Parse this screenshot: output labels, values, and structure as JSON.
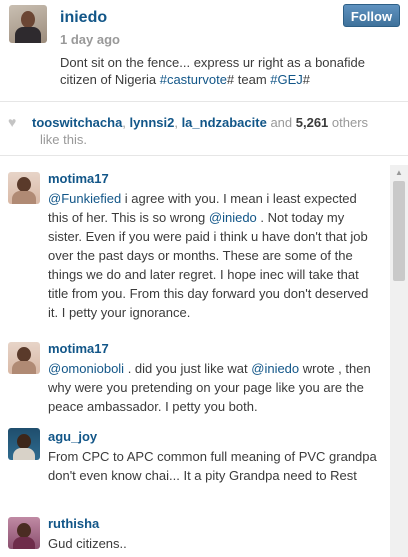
{
  "post": {
    "username": "iniedo",
    "time": "1 day ago",
    "follow_label": "Follow",
    "caption_text": "Dont sit on the fence... express ur right as a bonafide citizen of Nigeria ",
    "caption_tag1": "#casturvote",
    "caption_mid": "# team ",
    "caption_tag2": "#GEJ",
    "caption_end": "#"
  },
  "likes": {
    "user1": "tooswitchacha",
    "sep1": ", ",
    "user2": "lynnsi2",
    "sep2": ", ",
    "user3": "la_ndzabacite",
    "and": " and ",
    "count": "5,261",
    "others": " others",
    "like_text": "like this."
  },
  "comments": [
    {
      "username": "motima17",
      "mention": "@Funkiefied",
      "text1": " i agree with you. I mean i least expected this of her. This is so wrong ",
      "mention2": "@iniedo",
      "text2": " . Not today my sister. Even if you were paid i think u have don't that job over the past days or months. These are some of the things we do and later regret. I hope inec will take that title from you. From this day forward you don't deserved it. I petty your ignorance."
    },
    {
      "username": "motima17",
      "mention": "@omonioboli",
      "text1": " . did you just like wat ",
      "mention2": "@iniedo",
      "text2": " wrote , then why were you pretending on your page like you are the peace ambassador. I petty you both."
    },
    {
      "username": "agu_joy",
      "text": "From CPC to APC common full meaning of PVC grandpa don't even know chai... It a pity Grandpa need to Rest"
    },
    {
      "username": "ruthisha",
      "text": "Gud citizens.."
    }
  ],
  "icons": {
    "heart": "heart-icon",
    "scroll_up": "scroll-up-arrow-icon"
  },
  "colors": {
    "link": "#125688",
    "follow_button": "#3f729b"
  }
}
